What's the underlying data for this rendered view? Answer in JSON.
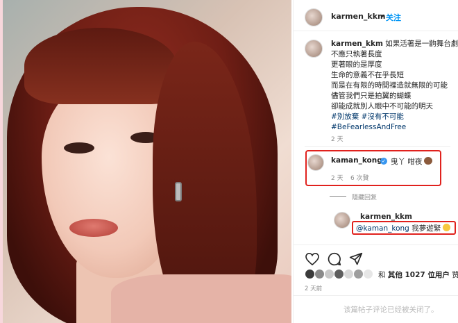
{
  "post": {
    "username": "karmen_kkm",
    "follow_label": "关注",
    "separator": "•"
  },
  "caption": {
    "username": "karmen_kkm",
    "lines": [
      "如果活著是一齣舞台劇",
      "不應只執著長度",
      "更著眼的是厚度",
      "生命的意義不在乎長短",
      "而是在有限的時間裡造就無限的可能",
      "儘管我們只是拍翼的蝴蝶",
      "卻能成就別人眼中不可能的明天"
    ],
    "hashtags_line1": "#別放棄 #沒有不可能",
    "hashtags_line2": "#BeFearlessAndFree",
    "time": "2 天"
  },
  "comment": {
    "username": "kaman_kong",
    "text": "曳丫 咁夜",
    "time": "2 天",
    "likes": "6 次贊",
    "hide_replies": "隱藏回复"
  },
  "reply": {
    "username": "karmen_kkm",
    "mention": "@kaman_kong",
    "text": "我夢遊緊"
  },
  "likes_summary": {
    "prefix": "和 ",
    "count_text": "其他 1027 位用户",
    "suffix": " 赞了"
  },
  "post_time": "2 天前",
  "watermark": "该篇帖子评论已经被关闭了。",
  "colors": {
    "accent_blue": "#0095f6",
    "highlight_red": "#e0211d",
    "hashtag": "#00376b"
  },
  "icons": [
    "heart-icon",
    "comment-icon",
    "share-icon",
    "verified-icon",
    "monkey-emoji-icon",
    "grin-emoji-icon"
  ]
}
